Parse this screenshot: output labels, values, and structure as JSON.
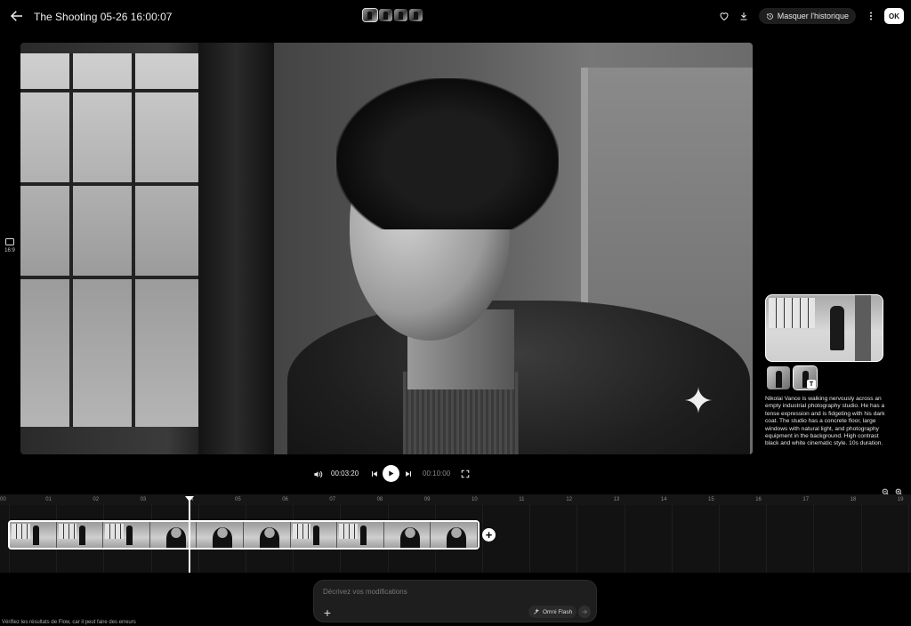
{
  "header": {
    "title": "The Shooting 05-26 16:00:07",
    "history_label": "Masquer l'historique",
    "ok_label": "OK"
  },
  "left_rail": {
    "aspect_label": "16:9"
  },
  "player": {
    "current_time": "00:03:20",
    "total_time": "00:10:00"
  },
  "reference": {
    "badge": "T",
    "description": "Nikolai Vance is walking nervously across an empty industrial photography studio. He has a tense expression and is fidgeting with his dark coat. The studio has a concrete floor, large windows with natural light, and photography equipment in the background. High contrast black and white cinematic style. 10s duration."
  },
  "timeline": {
    "ticks": [
      "00",
      "01",
      "02",
      "03",
      "04",
      "05",
      "06",
      "07",
      "08",
      "09",
      "10",
      "11",
      "12",
      "13",
      "14",
      "15",
      "16",
      "17",
      "18",
      "19"
    ],
    "playhead_seconds": 3.8
  },
  "prompt": {
    "placeholder": "Décrivez vos modifications",
    "model_label": "Omni Flash"
  },
  "footer": {
    "disclaimer": "Vérifiez les résultats de Flow, car il peut faire des erreurs"
  }
}
